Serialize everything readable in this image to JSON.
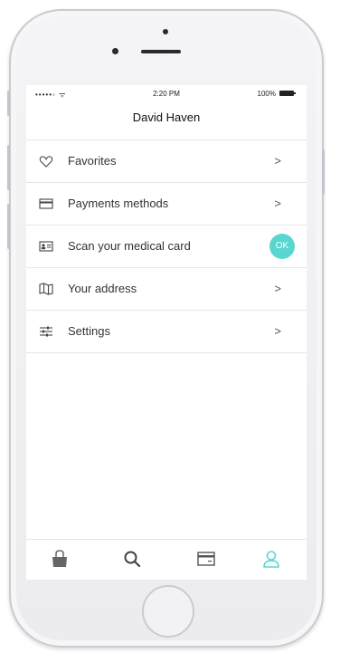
{
  "status_bar": {
    "carrier": "•••••◦ ᯤ",
    "time": "2:20 PM",
    "battery": "100%"
  },
  "header": {
    "title": "David Haven"
  },
  "menu": {
    "items": [
      {
        "label": "Favorites",
        "icon": "heart-icon",
        "accessory": ">"
      },
      {
        "label": "Payments methods",
        "icon": "card-icon",
        "accessory": ">"
      },
      {
        "label": "Scan your medical card",
        "icon": "id-card-icon",
        "accessory": "OK"
      },
      {
        "label": "Your address",
        "icon": "map-icon",
        "accessory": ">"
      },
      {
        "label": "Settings",
        "icon": "sliders-icon",
        "accessory": ">"
      }
    ]
  },
  "tabbar": {
    "tabs": [
      "shopping-bag-icon",
      "search-icon",
      "card-icon",
      "user-icon"
    ],
    "active_tab": "user-icon"
  },
  "colors": {
    "accent": "#58d6cf",
    "text": "#333333",
    "divider": "#e6e6e6"
  }
}
